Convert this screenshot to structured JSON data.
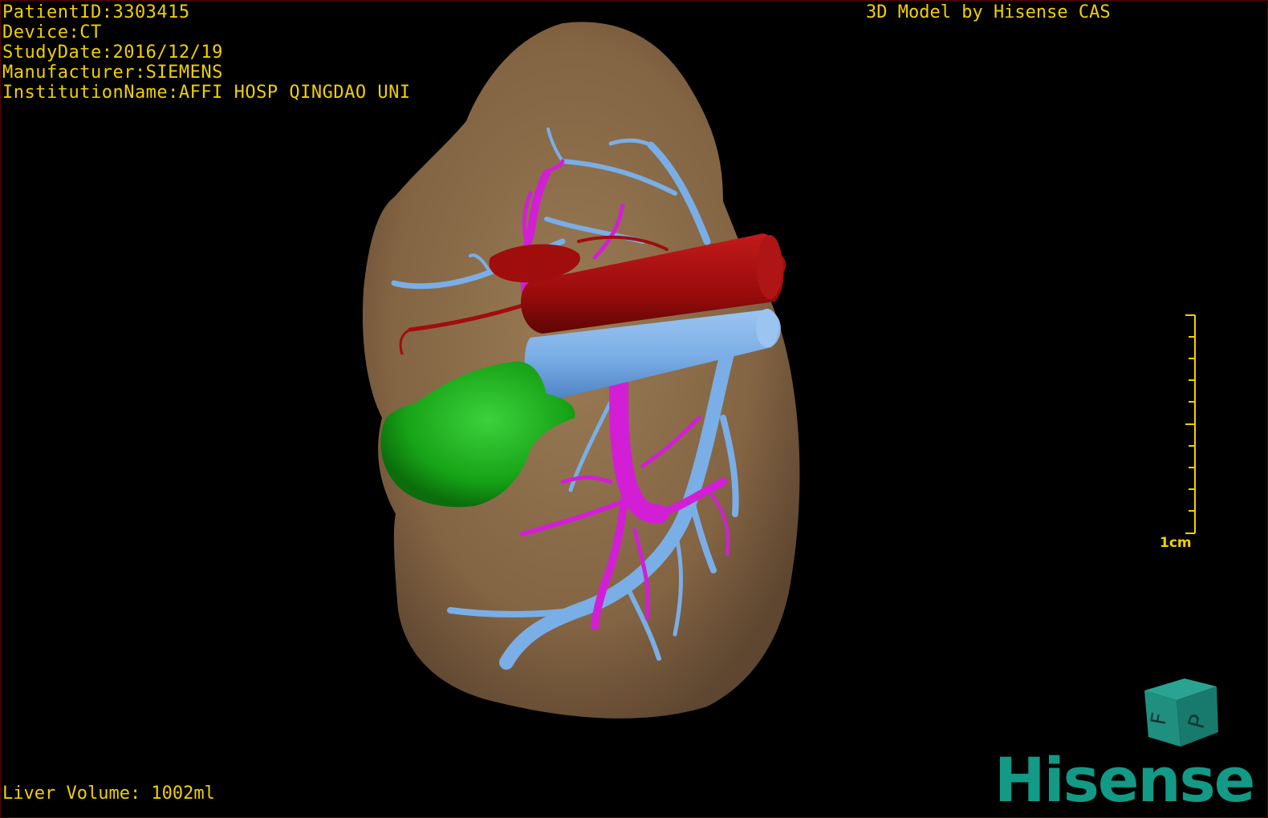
{
  "overlay": {
    "patient_id": "PatientID:3303415",
    "device": "Device:CT",
    "study_date": "StudyDate:2016/12/19",
    "manufacturer": "Manufacturer:SIEMENS",
    "institution": "InstitutionName:AFFI HOSP QINGDAO UNI",
    "credit": "3D Model by Hisense CAS",
    "liver_volume": "Liver Volume: 1002ml"
  },
  "scale": {
    "label": "1cm"
  },
  "orientation_cube": {
    "faces": [
      "F",
      "P"
    ],
    "color": "#1f8f80"
  },
  "logo": {
    "text": "Hisense",
    "color": "#129a86"
  },
  "colors": {
    "liver": "#8a6a45",
    "portal_vein": "#d21fd6",
    "hepatic_vein": "#7aaee6",
    "artery": "#a00d0d",
    "lesion": "#16a016",
    "overlay_text": "#f0d000"
  }
}
